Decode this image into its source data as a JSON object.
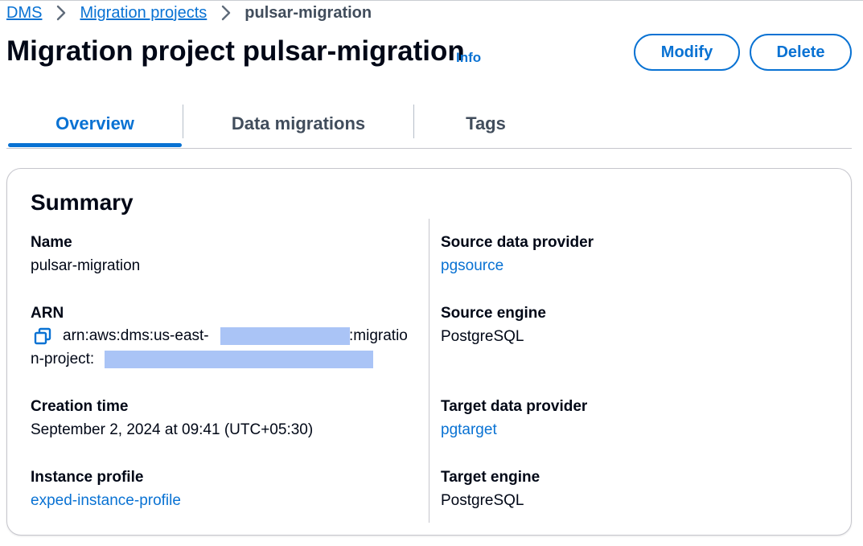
{
  "breadcrumb": {
    "items": [
      "DMS",
      "Migration projects"
    ],
    "current": "pulsar-migration"
  },
  "header": {
    "title": "Migration project pulsar-migration",
    "info_label": "Info",
    "modify_label": "Modify",
    "delete_label": "Delete"
  },
  "tabs": [
    {
      "label": "Overview",
      "active": true
    },
    {
      "label": "Data migrations",
      "active": false
    },
    {
      "label": "Tags",
      "active": false
    }
  ],
  "summary": {
    "title": "Summary",
    "name": {
      "label": "Name",
      "value": "pulsar-migration"
    },
    "arn": {
      "label": "ARN",
      "part1": "arn:aws:dms:us-east-",
      "part2": ":migratio",
      "part3": "n-project:"
    },
    "creation_time": {
      "label": "Creation time",
      "value": "September 2, 2024 at 09:41 (UTC+05:30)"
    },
    "instance_profile": {
      "label": "Instance profile",
      "value": "exped-instance-profile"
    },
    "source_data_provider": {
      "label": "Source data provider",
      "value": "pgsource"
    },
    "source_engine": {
      "label": "Source engine",
      "value": "PostgreSQL"
    },
    "target_data_provider": {
      "label": "Target data provider",
      "value": "pgtarget"
    },
    "target_engine": {
      "label": "Target engine",
      "value": "PostgreSQL"
    }
  },
  "icons": {
    "breadcrumb_separator": "chevron-right-icon",
    "arn_copy": "copy-icon"
  },
  "colors": {
    "link": "#0972d3",
    "text": "#000716",
    "muted": "#414d5c",
    "redaction": "#aac4f6"
  }
}
